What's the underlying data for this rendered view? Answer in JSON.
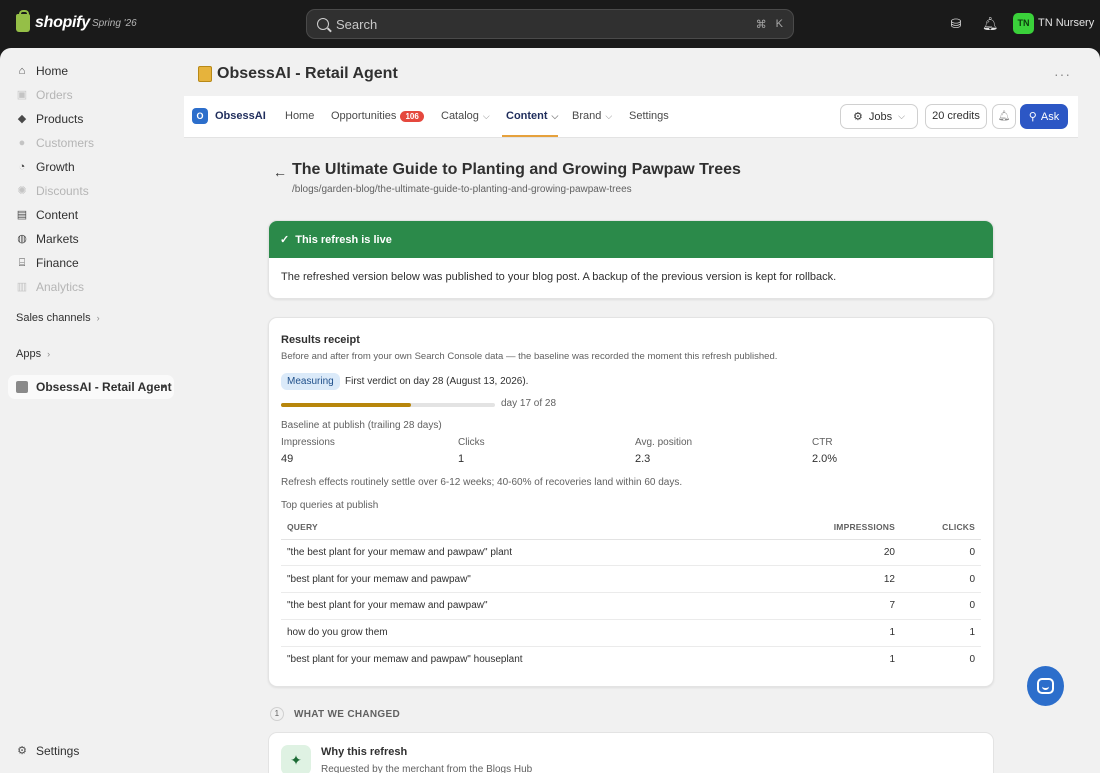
{
  "topbar": {
    "brand": "shopify",
    "edition": "Spring '26",
    "search_placeholder": "Search",
    "search_shortcut": [
      "⌘",
      "K"
    ],
    "store_initials": "TN",
    "store_name": "TN Nursery"
  },
  "sidebar": {
    "items": [
      {
        "label": "Home",
        "icon": "home-icon",
        "enabled": true
      },
      {
        "label": "Orders",
        "icon": "orders-icon",
        "enabled": false
      },
      {
        "label": "Products",
        "icon": "tag-icon",
        "enabled": true
      },
      {
        "label": "Customers",
        "icon": "person-icon",
        "enabled": false
      },
      {
        "label": "Growth",
        "icon": "growth-icon",
        "enabled": true
      },
      {
        "label": "Discounts",
        "icon": "discount-icon",
        "enabled": false
      },
      {
        "label": "Content",
        "icon": "content-icon",
        "enabled": true
      },
      {
        "label": "Markets",
        "icon": "globe-icon",
        "enabled": true
      },
      {
        "label": "Finance",
        "icon": "bank-icon",
        "enabled": true
      },
      {
        "label": "Analytics",
        "icon": "chart-bars-icon",
        "enabled": false
      }
    ],
    "sales_channels": "Sales channels",
    "apps": "Apps",
    "active_app": "ObsessAI - Retail Agent",
    "settings": "Settings"
  },
  "page": {
    "title": "ObsessAI - Retail Agent"
  },
  "appnav": {
    "brand_initial": "O",
    "brand_name": "ObsessAI",
    "tabs": [
      {
        "label": "Home"
      },
      {
        "label": "Opportunities",
        "badge": "106"
      },
      {
        "label": "Catalog"
      },
      {
        "label": "Content"
      },
      {
        "label": "Brand"
      },
      {
        "label": "Settings"
      }
    ],
    "jobs_label": "Jobs",
    "credits_label": "20 credits",
    "ask_label": "Ask"
  },
  "article": {
    "title": "The Ultimate Guide to Planting and Growing Pawpaw Trees",
    "path": "/blogs/garden-blog/the-ultimate-guide-to-planting-and-growing-pawpaw-trees"
  },
  "live_banner": {
    "title": "This refresh is live",
    "body": "The refreshed version below was published to your blog post. A backup of the previous version is kept for rollback."
  },
  "results": {
    "title": "Results receipt",
    "subtitle": "Before and after from your own Search Console data — the baseline was recorded the moment this refresh published.",
    "status": "Measuring",
    "verdict": "First verdict on day 28 (August 13, 2026).",
    "progress_current": 17,
    "progress_total": 28,
    "progress_label": "day 17 of 28",
    "baseline_label": "Baseline at publish (trailing 28 days)",
    "metrics": [
      {
        "label": "Impressions",
        "value": "49"
      },
      {
        "label": "Clicks",
        "value": "1"
      },
      {
        "label": "Avg. position",
        "value": "2.3"
      },
      {
        "label": "CTR",
        "value": "2.0%"
      }
    ],
    "note": "Refresh effects routinely settle over 6-12 weeks; 40-60% of recoveries land within 60 days.",
    "queries_label": "Top queries at publish",
    "columns": [
      "QUERY",
      "IMPRESSIONS",
      "CLICKS"
    ],
    "rows": [
      {
        "query": "\"the best plant for your memaw and pawpaw\" plant",
        "impressions": "20",
        "clicks": "0"
      },
      {
        "query": "\"best plant for your memaw and pawpaw\"",
        "impressions": "12",
        "clicks": "0"
      },
      {
        "query": "\"the best plant for your memaw and pawpaw\"",
        "impressions": "7",
        "clicks": "0"
      },
      {
        "query": "how do you grow them",
        "impressions": "1",
        "clicks": "1"
      },
      {
        "query": "\"best plant for your memaw and pawpaw\" houseplant",
        "impressions": "1",
        "clicks": "0"
      }
    ]
  },
  "changes": {
    "step": "1",
    "heading": "WHAT WE CHANGED",
    "why_title": "Why this refresh",
    "why_sub": "Requested by the merchant from the Blogs Hub"
  },
  "colors": {
    "live_green": "#2b8a4a",
    "accent_blue": "#2c57c5",
    "progress": "#b8860b",
    "badge_red": "#e5483e"
  }
}
